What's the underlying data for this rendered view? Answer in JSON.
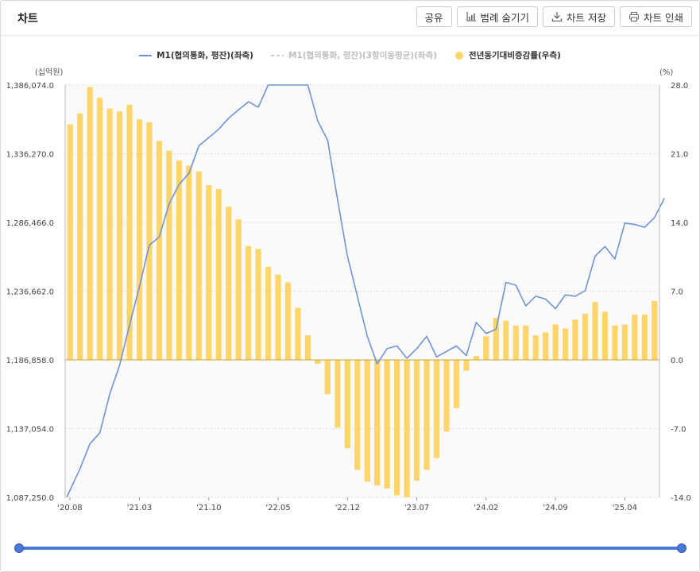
{
  "header": {
    "title": "차트",
    "buttons": {
      "share": "공유",
      "hide_legend": "범례 숨기기",
      "save_chart": "차트 저장",
      "print_chart": "차트 인쇄"
    }
  },
  "colors": {
    "line": "#6e93d6",
    "line_faded": "#cccccc",
    "bar": "#fdd56a",
    "zero": "#c8a53a"
  },
  "chart_data": {
    "type": "bar",
    "legend": [
      {
        "name": "M1(협의통화, 평잔)(좌축)",
        "kind": "line"
      },
      {
        "name": "M1(협의통화, 평잔)(3항이동평균)(좌측)",
        "kind": "dashed-line",
        "hidden": true
      },
      {
        "name": "전년동기대비증감률(우측)",
        "kind": "dot"
      }
    ],
    "left_axis_unit": "(십억원)",
    "right_axis_unit": "(%)",
    "left_ticks": [
      "1,386,074.0",
      "1,336,270.0",
      "1,286,466.0",
      "1,236,662.0",
      "1,186,858.0",
      "1,137,054.0",
      "1,087,250.0"
    ],
    "right_ticks": [
      "28.0",
      "21.0",
      "14.0",
      "7.0",
      "0.0",
      "-7.0",
      "-14.0"
    ],
    "ylim_left": [
      1087250.0,
      1386074.0
    ],
    "ylim_right": [
      -14.0,
      28.0
    ],
    "x_ticks": [
      "'20.08",
      "'21.03",
      "'21.10",
      "'22.05",
      "'22.12",
      "'23.07",
      "'24.02",
      "'24.09",
      "'25.04"
    ],
    "x_start": "2020-08",
    "x_end": "2025-08",
    "series": [
      {
        "name": "M1(협의통화, 평잔)(좌축)",
        "type": "line",
        "axis": "left",
        "values": [
          1087250,
          1108000,
          1126000,
          1134000,
          1162000,
          1183000,
          1212000,
          1240000,
          1270000,
          1276000,
          1300000,
          1314000,
          1322000,
          1342000,
          1348000,
          1354000,
          1362000,
          1368000,
          1374000,
          1370000,
          1396000,
          1402000,
          1400000,
          1412000,
          1393000,
          1360000,
          1346000,
          1303000,
          1262000,
          1233000,
          1204000,
          1184000,
          1195000,
          1197000,
          1188000,
          1195000,
          1204000,
          1189000,
          1193000,
          1197000,
          1190000,
          1214000,
          1206000,
          1209000,
          1243000,
          1241000,
          1226000,
          1233000,
          1231000,
          1224000,
          1234000,
          1233000,
          1237000,
          1262000,
          1269000,
          1260000,
          1286000,
          1285000,
          1283000,
          1290000,
          1304000
        ]
      },
      {
        "name": "전년동기대비증감률(우측)",
        "type": "bar",
        "axis": "right",
        "values": [
          24.0,
          25.1,
          27.8,
          26.7,
          25.6,
          25.3,
          26.0,
          24.5,
          24.2,
          22.3,
          21.3,
          20.3,
          19.8,
          19.2,
          17.8,
          17.4,
          15.6,
          14.3,
          11.6,
          11.3,
          9.5,
          8.7,
          7.9,
          5.3,
          2.5,
          -0.4,
          -3.5,
          -6.9,
          -9.0,
          -11.2,
          -12.4,
          -12.8,
          -13.1,
          -13.8,
          -14.0,
          -12.3,
          -11.2,
          -10.0,
          -7.3,
          -4.9,
          -1.1,
          0.4,
          2.4,
          4.3,
          4.0,
          3.5,
          3.5,
          2.5,
          2.8,
          3.6,
          3.2,
          4.1,
          4.7,
          5.9,
          4.9,
          3.5,
          3.6,
          4.6,
          4.6,
          6.0
        ]
      }
    ],
    "grid": true
  }
}
